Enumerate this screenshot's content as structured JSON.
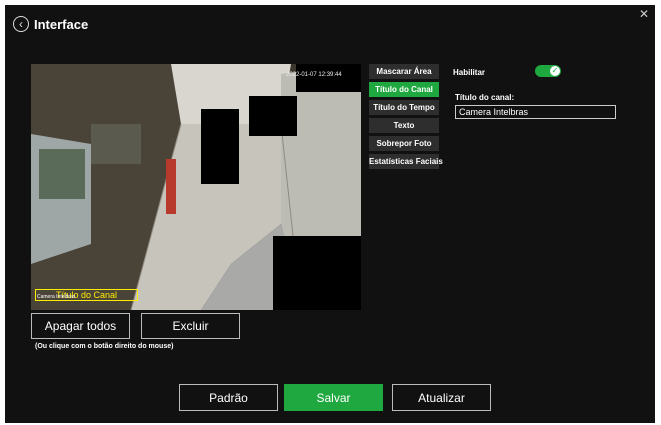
{
  "header": {
    "title": "Interface"
  },
  "preview": {
    "overlay_channel_title": "Título do Canal",
    "overlay_small_text": "Camera Intelbras",
    "overlay_timestamp": "2022-01-07 12:39:44"
  },
  "tabs": [
    {
      "label": "Mascarar Área",
      "active": false
    },
    {
      "label": "Título do Canal",
      "active": true
    },
    {
      "label": "Título do Tempo",
      "active": false
    },
    {
      "label": "Texto",
      "active": false
    },
    {
      "label": "Sobrepor Foto",
      "active": false
    },
    {
      "label": "Estatísticas Faciais",
      "active": false
    }
  ],
  "settings": {
    "enable_label": "Habilitar",
    "enabled": true,
    "channel_title_label": "Título do canal:",
    "channel_title_value": "Camera Intelbras"
  },
  "actions": {
    "clear_all": "Apagar todos",
    "delete": "Excluir",
    "hint": "(Ou clique com o botão direito do mouse)"
  },
  "footer": {
    "default": "Padrão",
    "save": "Salvar",
    "refresh": "Atualizar"
  },
  "colors": {
    "accent": "#1fa83f",
    "background": "#111111",
    "overlay": "#ffee00"
  }
}
